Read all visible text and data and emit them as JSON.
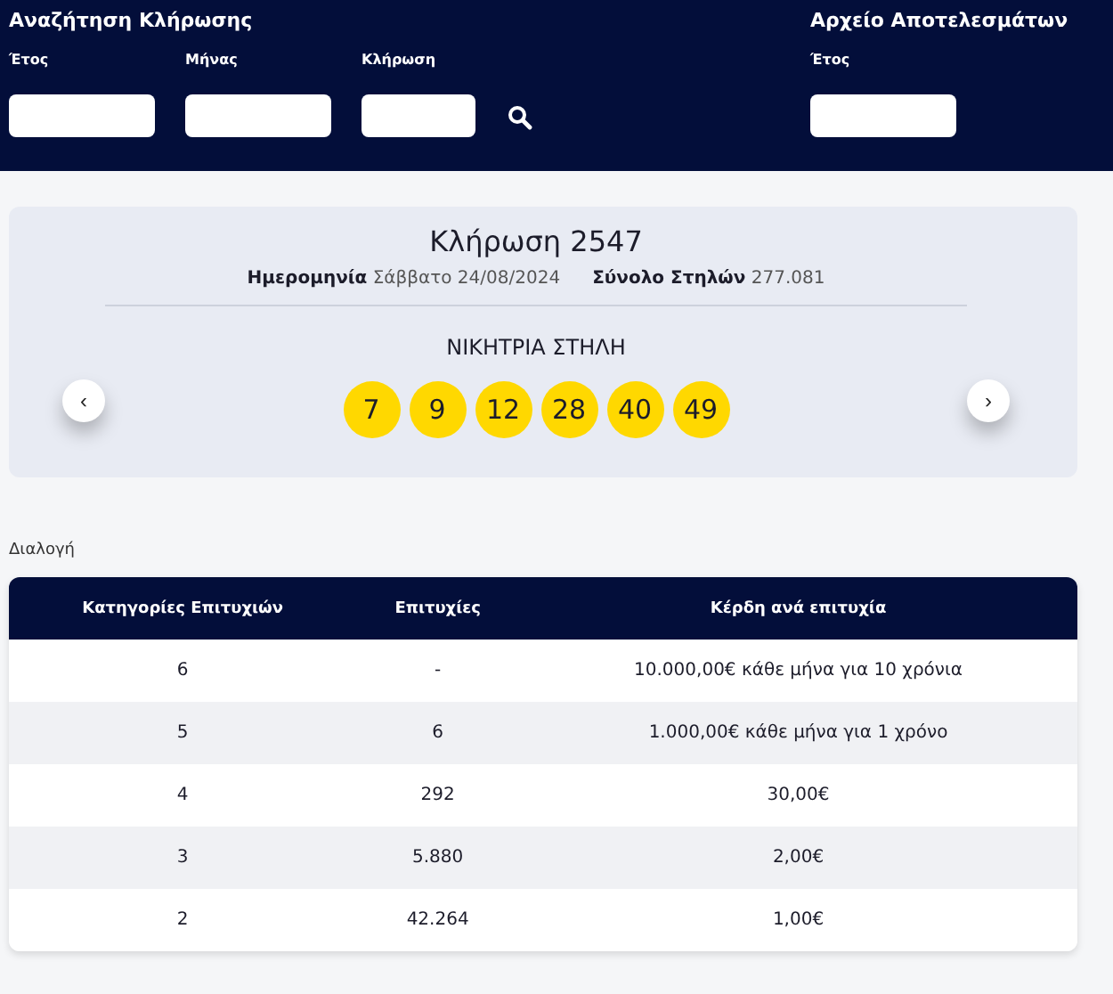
{
  "search": {
    "title": "Αναζήτηση Κλήρωσης",
    "fields": [
      {
        "label": "Έτος"
      },
      {
        "label": "Μήνας"
      },
      {
        "label": "Κλήρωση"
      }
    ]
  },
  "archive": {
    "title": "Αρχείο Αποτελεσμάτων",
    "fields": [
      {
        "label": "Έτος"
      }
    ]
  },
  "draw": {
    "title": "Κλήρωση 2547",
    "date_label": "Ημερομηνία",
    "date": "Σάββατο 24/08/2024",
    "total_label": "Σύνολο Στηλών",
    "total": "277.081",
    "winning_label": "ΝΙΚΗΤΡΙΑ ΣΤΗΛΗ",
    "numbers": [
      "7",
      "9",
      "12",
      "28",
      "40",
      "49"
    ],
    "prev": "‹",
    "next": "›"
  },
  "section": "Διαλογή",
  "table": {
    "columns": [
      "Κατηγορίες Επιτυχιών",
      "Επιτυχίες",
      "Κέρδη ανά επιτυχία"
    ],
    "rows": [
      [
        "6",
        "-",
        "10.000,00€ κάθε μήνα για 10 χρόνια"
      ],
      [
        "5",
        "6",
        "1.000,00€ κάθε μήνα για 1 χρόνο"
      ],
      [
        "4",
        "292",
        "30,00€"
      ],
      [
        "3",
        "5.880",
        "2,00€"
      ],
      [
        "2",
        "42.264",
        "1,00€"
      ]
    ]
  }
}
